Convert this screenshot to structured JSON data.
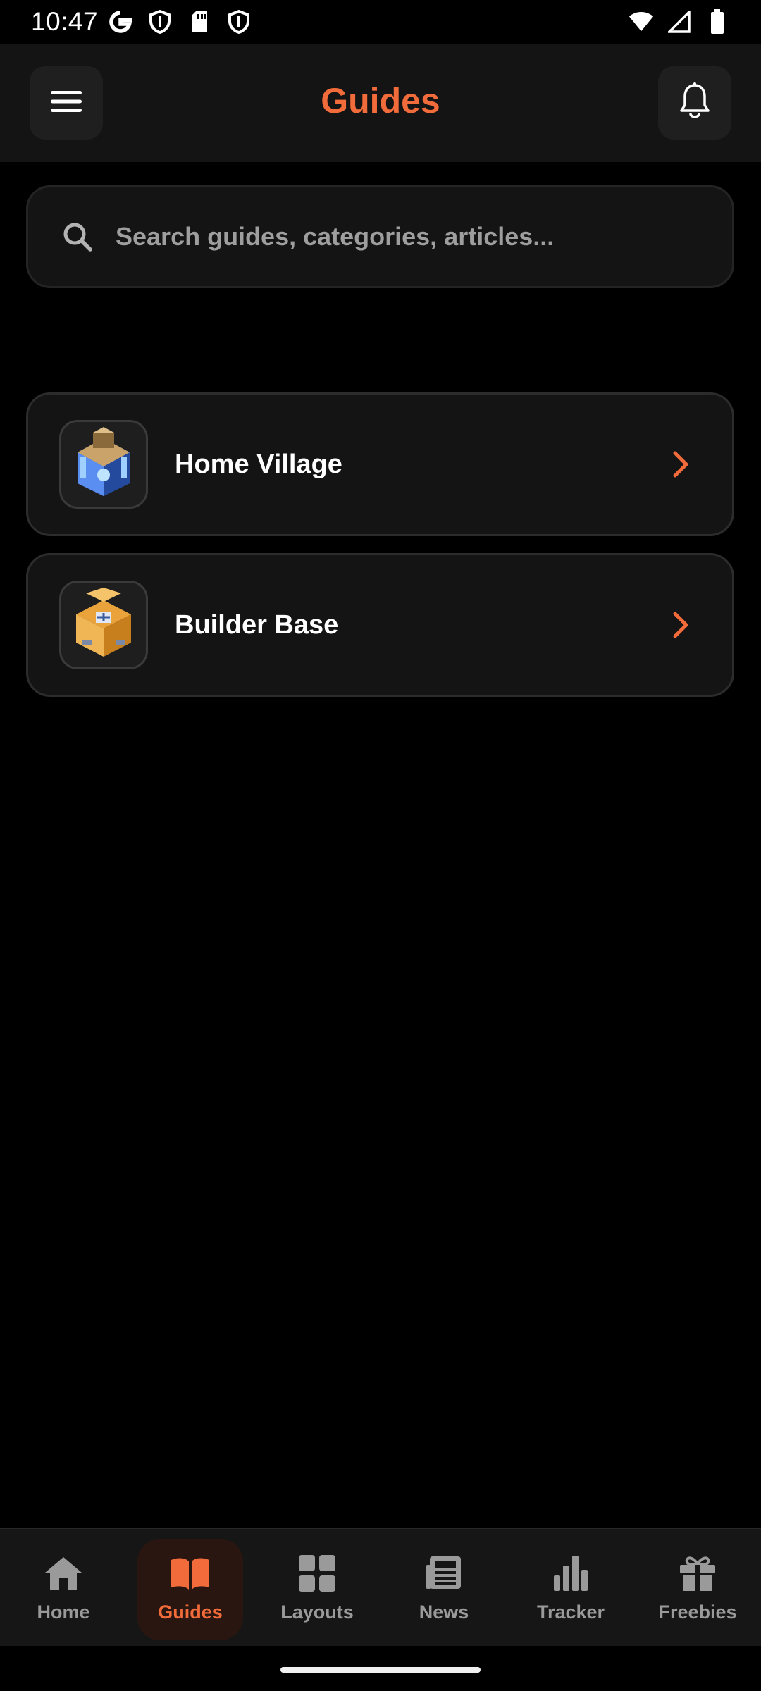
{
  "status_bar": {
    "time": "10:47",
    "left_icons": [
      "google-g-icon",
      "shield-icon",
      "sd-card-icon",
      "shield-icon"
    ],
    "right_icons": [
      "wifi-icon",
      "cell-signal-icon",
      "battery-icon"
    ]
  },
  "app_bar": {
    "title": "Guides",
    "menu_icon": "hamburger-menu-icon",
    "notification_icon": "bell-icon"
  },
  "search": {
    "placeholder": "Search guides, categories, articles...",
    "value": ""
  },
  "categories": [
    {
      "label": "Home Village",
      "thumbnail": "town-hall-image"
    },
    {
      "label": "Builder Base",
      "thumbnail": "builder-hall-image"
    }
  ],
  "bottom_nav": {
    "items": [
      {
        "label": "Home",
        "icon": "home-icon",
        "active": false
      },
      {
        "label": "Guides",
        "icon": "book-icon",
        "active": true
      },
      {
        "label": "Layouts",
        "icon": "grid-icon",
        "active": false
      },
      {
        "label": "News",
        "icon": "newspaper-icon",
        "active": false
      },
      {
        "label": "Tracker",
        "icon": "bar-chart-icon",
        "active": false
      },
      {
        "label": "Freebies",
        "icon": "gift-icon",
        "active": false
      }
    ]
  },
  "colors": {
    "accent": "#f26b3a",
    "background": "#000000",
    "surface": "#141414",
    "nav_inactive": "#9a9a9a"
  }
}
